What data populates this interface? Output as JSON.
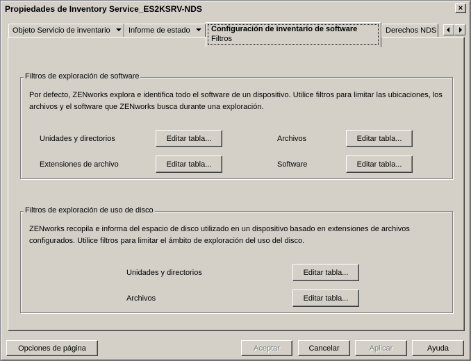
{
  "window": {
    "title": "Propiedades de Inventory Service_ES2KSRV-NDS",
    "close_label": "×"
  },
  "tabs": [
    {
      "label": "Objeto Servicio de inventario"
    },
    {
      "label": "Informe de estado"
    },
    {
      "label": "Configuración de inventario de software",
      "sub": "Filtros"
    },
    {
      "label": "Derechos NDS"
    }
  ],
  "software_filters": {
    "legend": "Filtros de exploración de software",
    "description": "Por defecto, ZENworks explora e identifica todo el software de un dispositivo. Utilice filtros para limitar las ubicaciones, los archivos y el software que ZENworks busca durante una exploración.",
    "rows": [
      {
        "label": "Unidades y directorios",
        "button": "Editar tabla..."
      },
      {
        "label": "Archivos",
        "button": "Editar tabla..."
      },
      {
        "label": "Extensiones de archivo",
        "button": "Editar tabla..."
      },
      {
        "label": "Software",
        "button": "Editar tabla..."
      }
    ]
  },
  "disk_filters": {
    "legend": "Filtros de exploración de uso de disco",
    "description": "ZENworks recopila e informa del espacio de disco utilizado en un dispositivo basado en extensiones de archivos configurados. Utilice filtros para limitar el ámbito de exploración del uso del disco.",
    "rows": [
      {
        "label": "Unidades y directorios",
        "button": "Editar tabla..."
      },
      {
        "label": "Archivos",
        "button": "Editar tabla..."
      }
    ]
  },
  "footer": {
    "page_options": "Opciones de página",
    "accept": "Aceptar",
    "cancel": "Cancelar",
    "apply": "Aplicar",
    "help": "Ayuda"
  }
}
